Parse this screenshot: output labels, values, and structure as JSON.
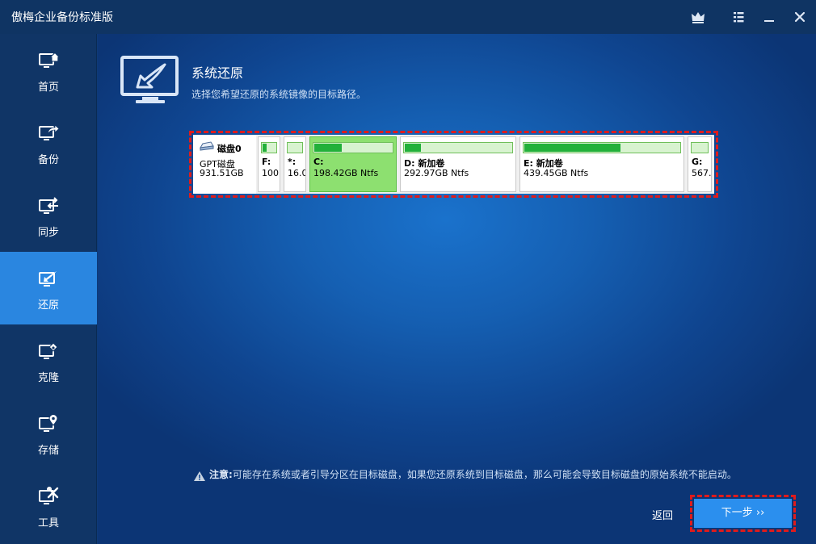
{
  "app": {
    "title": "傲梅企业备份标准版"
  },
  "titlebar": {
    "icons": [
      "crown-icon",
      "menu-icon",
      "minimize-icon",
      "close-icon"
    ]
  },
  "sidebar": {
    "items": [
      {
        "label": "首页",
        "icon": "home-icon"
      },
      {
        "label": "备份",
        "icon": "backup-icon"
      },
      {
        "label": "同步",
        "icon": "sync-icon"
      },
      {
        "label": "还原",
        "icon": "restore-icon",
        "active": true
      },
      {
        "label": "克隆",
        "icon": "clone-icon"
      },
      {
        "label": "存储",
        "icon": "storage-icon"
      },
      {
        "label": "工具",
        "icon": "tools-icon"
      }
    ]
  },
  "main": {
    "title": "系统还原",
    "subtitle": "选择您希望还原的系统镜像的目标路径。",
    "disk": {
      "name": "磁盘0",
      "type": "GPT磁盘",
      "size": "931.51GB",
      "partitions": [
        {
          "name": "F:",
          "size": "100.",
          "used": 0.3
        },
        {
          "name": "*:",
          "size": "16.0",
          "used": 0
        },
        {
          "name": "C:",
          "size": "198.42GB Ntfs",
          "used": 0.35,
          "selected": true
        },
        {
          "name": "D: 新加卷",
          "size": "292.97GB Ntfs",
          "used": 0.15
        },
        {
          "name": "E: 新加卷",
          "size": "439.45GB Ntfs",
          "used": 0.62
        },
        {
          "name": "G:",
          "size": "567.",
          "used": 0
        }
      ]
    },
    "note": {
      "label": "注意:",
      "text": "可能存在系统或者引导分区在目标磁盘，如果您还原系统到目标磁盘，那么可能会导致目标磁盘的原始系统不能启动。"
    },
    "back_label": "返回",
    "next_label": "下一步 ››"
  },
  "colors": {
    "active_nav": "#2a86e0",
    "selected_partition": "#8de070",
    "usage_fill": "#22b03a",
    "highlight_outline": "#e01b1b",
    "next_button": "#2b8fee"
  }
}
